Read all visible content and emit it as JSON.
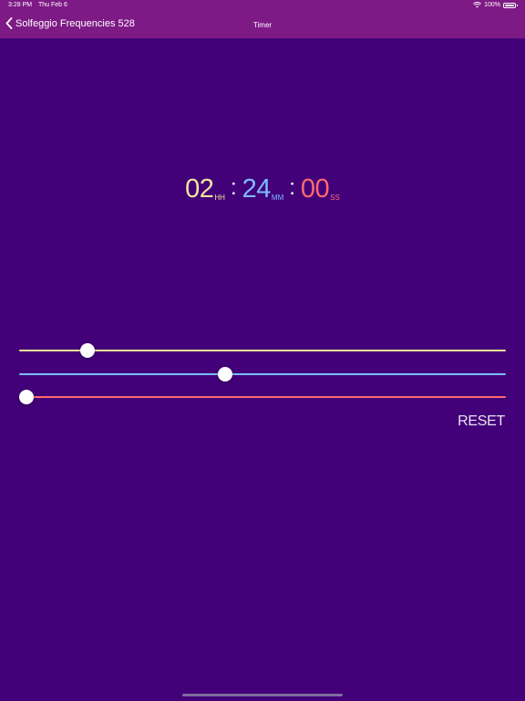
{
  "status_bar": {
    "time": "3:28 PM",
    "date": "Thu Feb 6",
    "battery": "100%",
    "battery_level": 1.0
  },
  "nav": {
    "back_label": "Solfeggio Frequencies 528",
    "title": "Timer"
  },
  "timer": {
    "hours": "02",
    "hours_unit": "HH",
    "minutes": "24",
    "minutes_unit": "MM",
    "seconds": "00",
    "seconds_unit": "SS",
    "separator": ":"
  },
  "sliders": {
    "hours": {
      "value": 0.13,
      "color": "#f1e39a"
    },
    "minutes": {
      "value": 0.42,
      "color": "#7cbcff"
    },
    "seconds": {
      "value": 0.0,
      "color": "#ff6a6e"
    }
  },
  "reset_label": "RESET",
  "colors": {
    "background": "#420079",
    "bar": "#7e1a86"
  }
}
